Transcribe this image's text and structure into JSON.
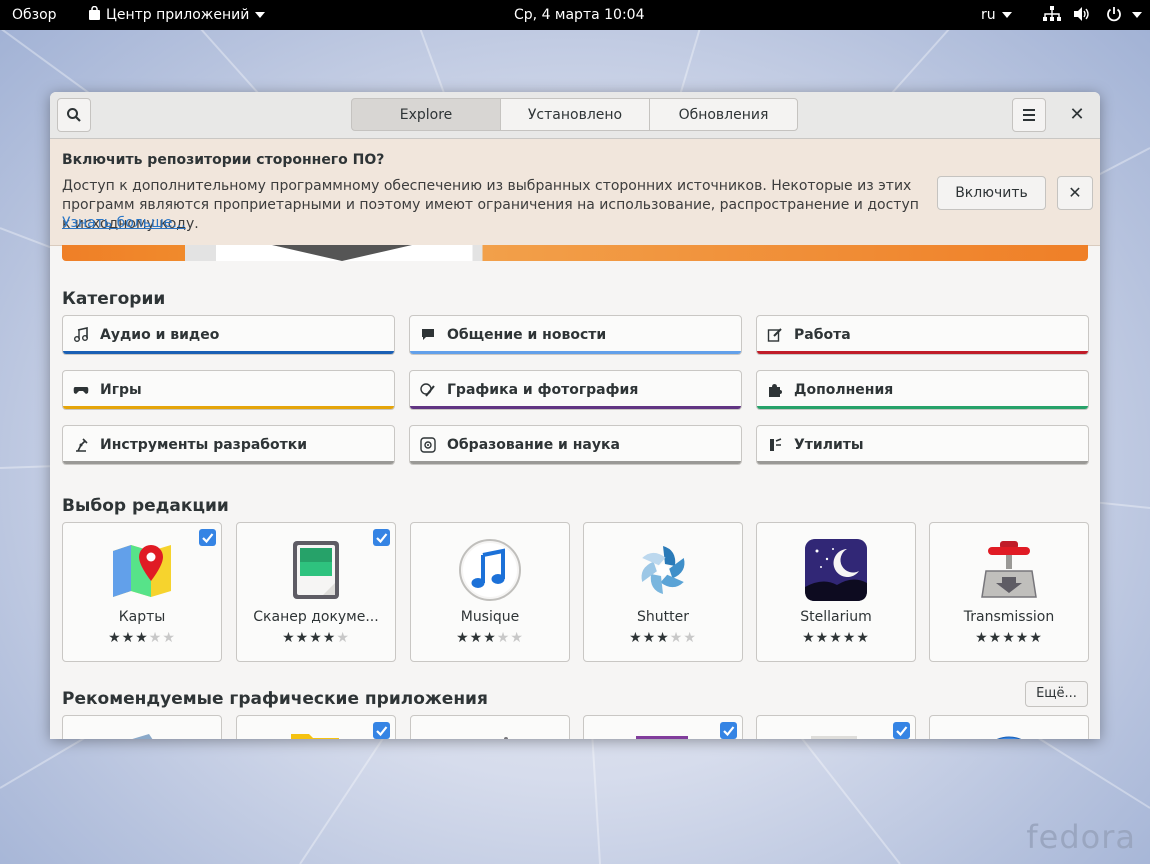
{
  "topbar": {
    "activities": "Обзор",
    "app_menu": "Центр приложений",
    "clock": "Ср, 4 марта  10:04",
    "lang": "ru"
  },
  "header": {
    "tabs": [
      {
        "label": "Explore",
        "active": true
      },
      {
        "label": "Установлено",
        "active": false
      },
      {
        "label": "Обновления",
        "active": false
      }
    ]
  },
  "infobar": {
    "title": "Включить репозитории стороннего ПО?",
    "text": "Доступ к дополнительному программному обеспечению из выбранных сторонних источников. Некоторые из этих программ являются проприетарными и поэтому имеют ограничения на использование, распространение и доступ к исходному коду.",
    "link": "Узнать больше...",
    "enable_label": "Включить"
  },
  "categories": {
    "title": "Категории",
    "items": [
      {
        "label": "Аудио и видео",
        "icon": "music-note-icon",
        "color": "#1a5fb4"
      },
      {
        "label": "Общение и новости",
        "icon": "chat-bubble-icon",
        "color": "#62a0ea"
      },
      {
        "label": "Работа",
        "icon": "edit-icon",
        "color": "#c01c28"
      },
      {
        "label": "Игры",
        "icon": "gamepad-icon",
        "color": "#e5a50a"
      },
      {
        "label": "Графика и фотография",
        "icon": "brush-icon",
        "color": "#613583"
      },
      {
        "label": "Дополнения",
        "icon": "puzzle-icon",
        "color": "#26a269"
      },
      {
        "label": "Инструменты разработки",
        "icon": "robot-arm-icon",
        "color": "#9a9996"
      },
      {
        "label": "Образование и наука",
        "icon": "atom-icon",
        "color": "#9a9996"
      },
      {
        "label": "Утилиты",
        "icon": "utilities-icon",
        "color": "#9a9996"
      }
    ]
  },
  "editors_picks": {
    "title": "Выбор редакции",
    "apps": [
      {
        "name": "Карты",
        "rating": 3,
        "checked": true,
        "icon": "maps-icon"
      },
      {
        "name": "Сканер докуме...",
        "rating": 4,
        "checked": true,
        "icon": "scanner-icon"
      },
      {
        "name": "Musique",
        "rating": 3,
        "checked": false,
        "icon": "musique-icon"
      },
      {
        "name": "Shutter",
        "rating": 3,
        "checked": false,
        "icon": "shutter-icon"
      },
      {
        "name": "Stellarium",
        "rating": 5,
        "checked": false,
        "icon": "stellarium-icon"
      },
      {
        "name": "Transmission",
        "rating": 5,
        "checked": false,
        "icon": "transmission-icon"
      }
    ]
  },
  "recommended": {
    "title": "Рекомендуемые графические приложения",
    "more_label": "Ещё...",
    "checks": [
      false,
      true,
      false,
      true,
      true,
      false
    ]
  },
  "desktop": {
    "logo": "fedora"
  }
}
